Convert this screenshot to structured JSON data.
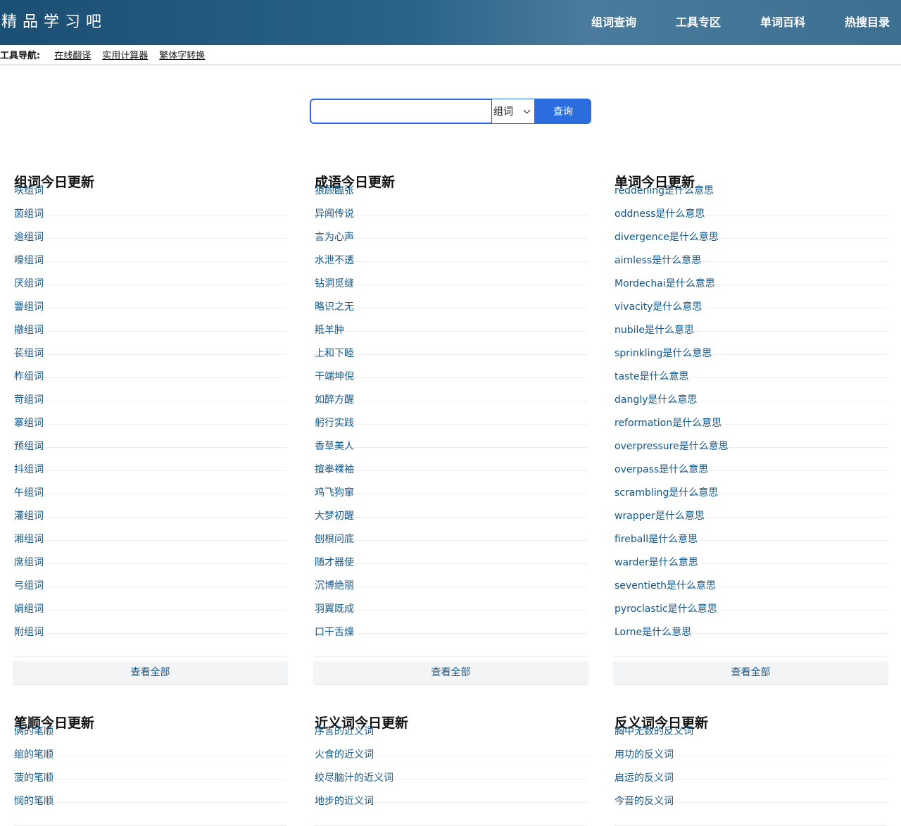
{
  "header": {
    "logo": "精品学习吧",
    "nav": [
      "组词查询",
      "工具专区",
      "单词百科",
      "热搜目录"
    ]
  },
  "toolbar": {
    "label": "工具导航:",
    "links": [
      "在线翻译",
      "实用计算器",
      "繁体字转换"
    ]
  },
  "search": {
    "value": "",
    "placeholder": "",
    "select_value": "组词",
    "button_label": "查询"
  },
  "sections": [
    {
      "title": "组词今日更新",
      "items": [
        "呋组词",
        "茵组词",
        "逾组词",
        "嚎组词",
        "厌组词",
        "謽组词",
        "撤组词",
        "苌组词",
        "柞组词",
        "苛组词",
        "寨组词",
        "预组词",
        "抖组词",
        "午组词",
        "灌组词",
        "湘组词",
        "席组词",
        "弓组词",
        "娟组词",
        "附组词"
      ],
      "more": "查看全部"
    },
    {
      "title": "成语今日更新",
      "items": [
        "狼顾臨张",
        "异闻传说",
        "言为心声",
        "水泄不透",
        "钻洞觅缝",
        "略识之无",
        "羝羊肿",
        "上和下睦",
        "干端坤倪",
        "如醉方醒",
        "躬行实践",
        "香草美人",
        "揎拳裸袖",
        "鸡飞狗窜",
        "大梦初醒",
        "刨根问底",
        "随才器使",
        "沉博绝丽",
        "羽翼既成",
        "口干舌燥"
      ],
      "more": "查看全部"
    },
    {
      "title": "单词今日更新",
      "items": [
        "reddening是什么意思",
        "oddness是什么意思",
        "divergence是什么意思",
        "aimless是什么意思",
        "Mordechai是什么意思",
        "vivacity是什么意思",
        "nubile是什么意思",
        "sprinkling是什么意思",
        "taste是什么意思",
        "dangly是什么意思",
        "reformation是什么意思",
        "overpressure是什么意思",
        "overpass是什么意思",
        "scrambling是什么意思",
        "wrapper是什么意思",
        "fireball是什么意思",
        "warder是什么意思",
        "seventieth是什么意思",
        "pyroclastic是什么意思",
        "Lorne是什么意思"
      ],
      "more": "查看全部"
    },
    {
      "title": "笔顺今日更新",
      "items": [
        "俩的笔顺",
        "绾的笔顺",
        "菠的笔顺",
        "悯的笔顺"
      ]
    },
    {
      "title": "近义词今日更新",
      "items": [
        "序言的近义词",
        "火食的近义词",
        "绞尽脑汁的近义词",
        "地步的近义词"
      ]
    },
    {
      "title": "反义词今日更新",
      "items": [
        "胸中无数的反义词",
        "用功的反义词",
        "启运的反义词",
        "今音的反义词"
      ]
    }
  ]
}
